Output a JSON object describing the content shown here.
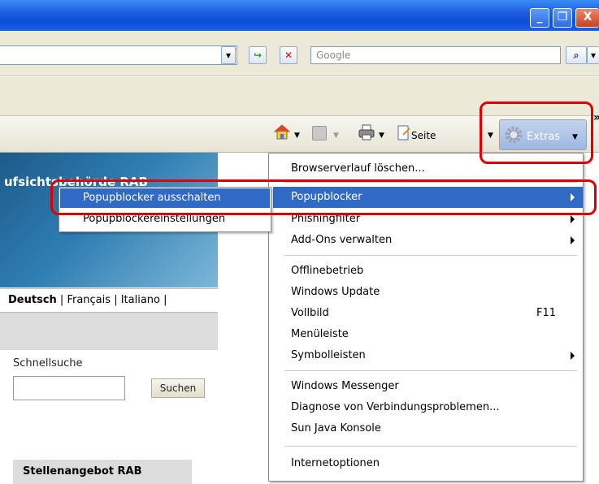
{
  "window": {
    "minimize_glyph": "_",
    "restore_glyph": "❐",
    "close_glyph": "X"
  },
  "address_bar": {
    "dropdown_glyph": "▾",
    "go_glyph": "↪",
    "stop_glyph": "✕"
  },
  "search": {
    "placeholder": "Google",
    "button_glyph": "⌕",
    "dropdown_glyph": "▾"
  },
  "command_bar": {
    "home_icon": "home-icon",
    "feeds_icon": "feeds-icon",
    "print_icon": "print-icon",
    "page_label": "Seite",
    "extras_label": "Extras",
    "chevron": "»"
  },
  "page": {
    "banner_title": "ufsichtsbehörde RAB",
    "languages": {
      "de": "Deutsch",
      "fr": "Français",
      "it": "Italiano",
      "sep": "|"
    },
    "quicksearch_label": "Schnellsuche",
    "search_button": "Suchen",
    "jobs_title": "Stellenangebot RAB"
  },
  "extras_menu": {
    "items": [
      {
        "label": "Browserverlauf löschen..."
      },
      {
        "label": "Popupblocker"
      },
      {
        "label": "Phishingfilter"
      },
      {
        "label": "Add-Ons verwalten"
      },
      {
        "label": "Offlinebetrieb"
      },
      {
        "label": "Windows Update"
      },
      {
        "label": "Vollbild",
        "shortcut": "F11"
      },
      {
        "label": "Menüleiste"
      },
      {
        "label": "Symbolleisten"
      },
      {
        "label": "Windows Messenger"
      },
      {
        "label": "Diagnose von Verbindungsproblemen..."
      },
      {
        "label": "Sun Java Konsole"
      },
      {
        "label": "Internetoptionen"
      }
    ]
  },
  "popup_submenu": {
    "items": [
      {
        "label": "Popupblocker ausschalten"
      },
      {
        "label": "Popupblockereinstellungen"
      }
    ]
  },
  "colors": {
    "highlight": "#316ac5",
    "annotation": "#e10000",
    "titlebar": "#0b4fd6"
  }
}
